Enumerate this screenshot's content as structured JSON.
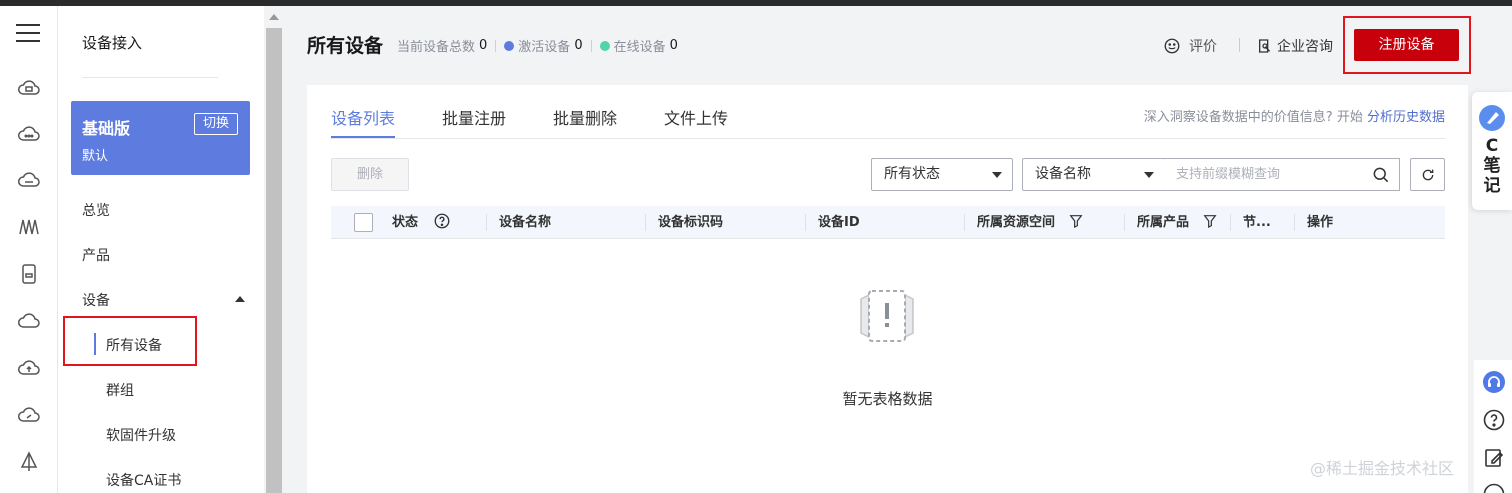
{
  "sidebar": {
    "title": "设备接入",
    "edition": {
      "name": "基础版",
      "sub": "默认",
      "switch_label": "切换"
    },
    "items": {
      "overview": "总览",
      "product": "产品",
      "device": "设备",
      "all_devices": "所有设备",
      "groups": "群组",
      "firmware": "软固件升级",
      "ca_cert": "设备CA证书"
    }
  },
  "header": {
    "title": "所有设备",
    "total_label": "当前设备总数",
    "total_value": "0",
    "active_label": "激活设备",
    "active_value": "0",
    "online_label": "在线设备",
    "online_value": "0",
    "rate_label": "评价",
    "consult_label": "企业咨询",
    "register_label": "注册设备"
  },
  "tabs": [
    "设备列表",
    "批量注册",
    "批量删除",
    "文件上传"
  ],
  "insight": {
    "text": "深入洞察设备数据中的价值信息? 开始",
    "link": "分析历史数据"
  },
  "toolbar": {
    "delete_label": "删除",
    "status_select": "所有状态",
    "field_select": "设备名称",
    "search_placeholder": "支持前缀模糊查询"
  },
  "table": {
    "columns": [
      "状态",
      "设备名称",
      "设备标识码",
      "设备ID",
      "所属资源空间",
      "所属产品",
      "节...",
      "操作"
    ],
    "empty_text": "暂无表格数据"
  },
  "widgets": {
    "note_label": "C笔记"
  },
  "watermark": "@稀土掘金技术社区",
  "colors": {
    "accent": "#5e7ce0",
    "register": "#c7000b",
    "active_dot": "#5e7ce0",
    "online_dot": "#50d4ab",
    "highlight": "#e0151d"
  }
}
